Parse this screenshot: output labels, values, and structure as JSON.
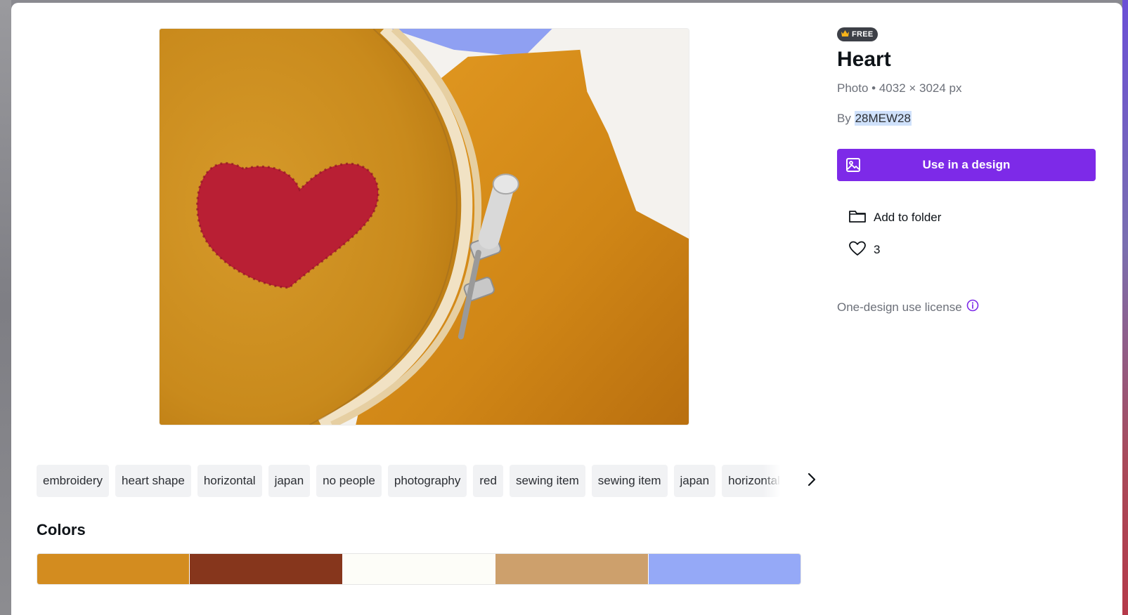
{
  "image": {
    "badge": "FREE",
    "title": "Heart",
    "meta": "Photo • 4032 × 3024 px",
    "by_prefix": "By",
    "author": "28MEW28"
  },
  "actions": {
    "use_in_design": "Use in a design",
    "add_to_folder": "Add to folder",
    "likes": "3",
    "license": "One-design use license"
  },
  "tags": [
    "embroidery",
    "heart shape",
    "horizontal",
    "japan",
    "no people",
    "photography",
    "red",
    "sewing item",
    "sewing item",
    "japan",
    "horizontal"
  ],
  "colors": {
    "heading": "Colors",
    "swatches": [
      "#d38c1f",
      "#86361c",
      "#fdfdf8",
      "#cda06c",
      "#95a9f7"
    ]
  },
  "icons": {
    "badge": "crown-icon",
    "use": "image-icon",
    "folder": "folder-icon",
    "like": "heart-outline-icon",
    "info": "info-icon",
    "next": "chevron-right-icon"
  }
}
